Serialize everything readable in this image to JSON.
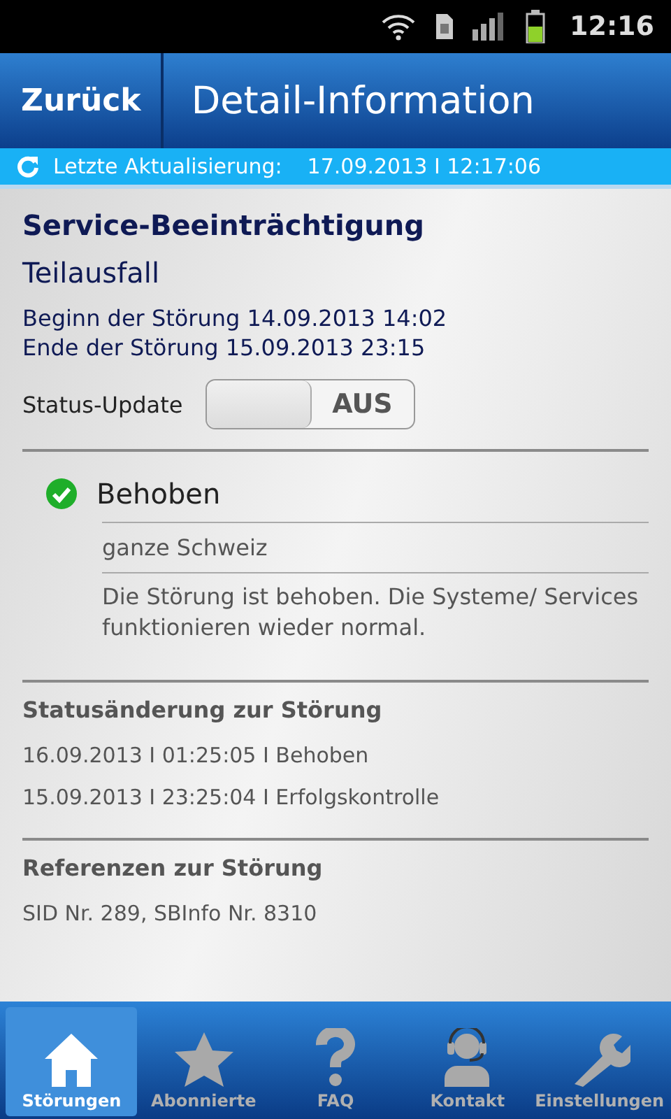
{
  "status_bar": {
    "time": "12:16"
  },
  "header": {
    "back": "Zurück",
    "title": "Detail-Information"
  },
  "update_bar": {
    "label": "Letzte Aktualisierung:",
    "value": "17.09.2013 I 12:17:06"
  },
  "detail": {
    "category": "Service-Beeinträchtigung",
    "type": "Teilausfall",
    "start": "Beginn der Störung 14.09.2013 14:02",
    "end": "Ende der Störung 15.09.2013 23:15",
    "status_update": {
      "label": "Status-Update",
      "on": false,
      "state_text": "AUS"
    }
  },
  "status": {
    "title": "Behoben",
    "resolved": true,
    "region": "ganze Schweiz",
    "description": "Die Störung ist behoben. Die Systeme/ Services funktionieren wieder normal."
  },
  "history": {
    "title": "Statusänderung zur Störung",
    "entries": [
      "16.09.2013 I 01:25:05 I Behoben",
      "15.09.2013 I 23:25:04 I Erfolgskontrolle"
    ]
  },
  "references": {
    "title": "Referenzen zur Störung",
    "text": "SID Nr. 289, SBInfo Nr. 8310"
  },
  "tabs": [
    {
      "kind": "home",
      "label": "Störungen",
      "selected": true
    },
    {
      "kind": "star",
      "label": "Abonnierte",
      "selected": false
    },
    {
      "kind": "help",
      "label": "FAQ",
      "selected": false
    },
    {
      "kind": "headset",
      "label": "Kontakt",
      "selected": false
    },
    {
      "kind": "wrench",
      "label": "Einstellungen",
      "selected": false
    }
  ]
}
